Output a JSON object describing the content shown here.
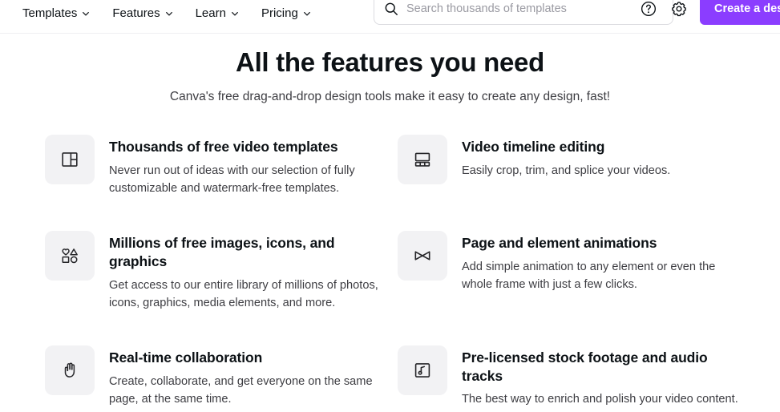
{
  "header": {
    "nav_items": [
      {
        "label": "Templates",
        "icon": "chevron-down-icon"
      },
      {
        "label": "Features",
        "icon": "chevron-down-icon"
      },
      {
        "label": "Learn",
        "icon": "chevron-down-icon"
      },
      {
        "label": "Pricing",
        "icon": "chevron-down-icon"
      }
    ],
    "search": {
      "placeholder": "Search thousands of templates",
      "value": "",
      "icon": "search-icon"
    },
    "help_icon": "question-mark-circle-icon",
    "settings_icon": "gear-icon",
    "cta_label": "Create a design",
    "cta_color": "#8b3dff"
  },
  "main": {
    "title": "All the features you need",
    "subtitle": "Canva's free drag-and-drop design tools make it easy to create any design, fast!",
    "features": [
      {
        "icon": "layout-template-icon",
        "title": "Thousands of free video templates",
        "desc": "Never run out of ideas with our selection of fully customizable and watermark-free templates."
      },
      {
        "icon": "video-timeline-icon",
        "title": "Video timeline editing",
        "desc": "Easily crop, trim, and splice your videos."
      },
      {
        "icon": "shapes-elements-icon",
        "title": "Millions of free images, icons, and graphics",
        "desc": "Get access to our entire library of millions of photos, icons, graphics, media elements, and more."
      },
      {
        "icon": "animation-bowtie-icon",
        "title": "Page and element animations",
        "desc": "Add simple animation to any element or even the whole frame with just a few clicks."
      },
      {
        "icon": "hand-wave-icon",
        "title": "Real-time collaboration",
        "desc": "Create, collaborate, and get everyone on the same page, at the same time."
      },
      {
        "icon": "music-note-square-icon",
        "title": "Pre-licensed stock footage and audio tracks",
        "desc": "The best way to enrich and polish your video content."
      }
    ]
  },
  "colors": {
    "brand_purple": "#8b3dff",
    "text_primary": "#0d1216",
    "text_secondary": "#3d3d42",
    "tile_bg": "#f2f2f4"
  }
}
